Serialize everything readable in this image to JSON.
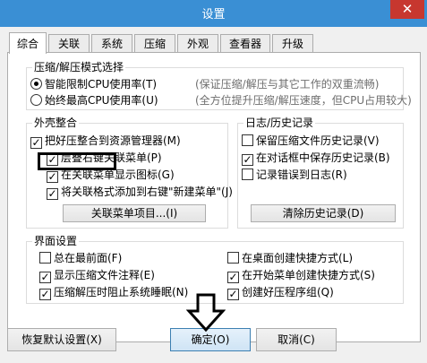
{
  "window": {
    "title": "设置",
    "close_label": "✕"
  },
  "tabs": [
    {
      "label": "综合",
      "active": true
    },
    {
      "label": "关联",
      "active": false
    },
    {
      "label": "系统",
      "active": false
    },
    {
      "label": "压缩",
      "active": false
    },
    {
      "label": "外观",
      "active": false
    },
    {
      "label": "查看器",
      "active": false
    },
    {
      "label": "升级",
      "active": false
    }
  ],
  "compress_mode": {
    "title": "压缩/解压模式选择",
    "options": [
      {
        "label": "智能限制CPU使用率(T)",
        "hint": "(保证压缩/解压与其它工作的双重流畅)",
        "selected": true
      },
      {
        "label": "始终最高CPU使用率(U)",
        "hint": "(全方位提升压缩/解压速度，但CPU占用较大)",
        "selected": false
      }
    ]
  },
  "shell": {
    "title": "外壳整合",
    "items": [
      {
        "label": "把好压整合到资源管理器(M)",
        "checked": true
      },
      {
        "label": "层叠右键关联菜单(P)",
        "checked": true
      },
      {
        "label": "在关联菜单显示图标(G)",
        "checked": true
      },
      {
        "label": "将关联格式添加到右键\"新建菜单\"(J)",
        "checked": true
      }
    ],
    "button_label": "关联菜单项目...(I)"
  },
  "history": {
    "title": "日志/历史记录",
    "items": [
      {
        "label": "保留压缩文件历史记录(V)",
        "checked": false
      },
      {
        "label": "在对话框中保存历史记录(B)",
        "checked": true
      },
      {
        "label": "记录错误到日志(R)",
        "checked": false
      }
    ],
    "button_label": "清除历史记录(D)"
  },
  "ui": {
    "title": "界面设置",
    "left": [
      {
        "label": "总在最前面(F)",
        "checked": false
      },
      {
        "label": "显示压缩文件注释(E)",
        "checked": true
      },
      {
        "label": "压缩解压时阻止系统睡眠(N)",
        "checked": true
      }
    ],
    "right": [
      {
        "label": "在桌面创建快捷方式(L)",
        "checked": false
      },
      {
        "label": "在开始菜单创建快捷方式(S)",
        "checked": true
      },
      {
        "label": "创建好压程序组(Q)",
        "checked": true
      }
    ]
  },
  "footer": {
    "reset_label": "恢复默认设置(X)",
    "ok_label": "确定(O)",
    "cancel_label": "取消(C)"
  }
}
